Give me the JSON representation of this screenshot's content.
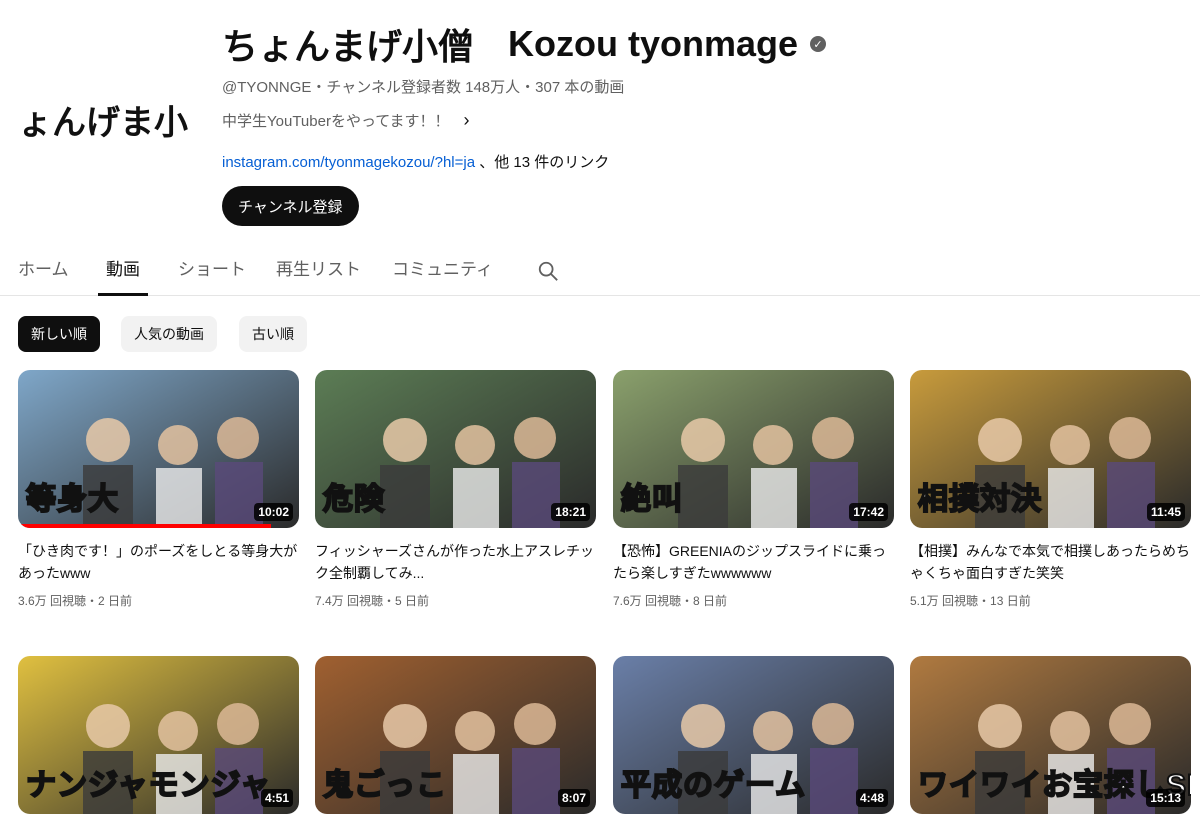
{
  "channel": {
    "avatar_text": "ちょんげま小僧",
    "name_jp": "ちょんまげ小僧",
    "name_en": "Kozou tyonmage",
    "meta": "@TYONNGE・チャンネル登録者数 148万人・307 本の動画",
    "description": "中学生YouTuberをやってます！！",
    "link": "instagram.com/tyonmagekozou/?hl=ja",
    "link_suffix": "、他 13 件のリンク",
    "subscribe_label": "チャンネル登録"
  },
  "tabs": [
    {
      "label": "ホーム"
    },
    {
      "label": "動画"
    },
    {
      "label": "ショート"
    },
    {
      "label": "再生リスト"
    },
    {
      "label": "コミュニティ"
    }
  ],
  "chips": [
    {
      "label": "新しい順"
    },
    {
      "label": "人気の動画"
    },
    {
      "label": "古い順"
    }
  ],
  "videos": [
    {
      "title": "「ひき肉です！」のポーズをしとる等身大があったwww",
      "meta": "3.6万 回視聴・2 日前",
      "duration": "10:02",
      "overlay": "等身大",
      "watched_fraction": 0.9,
      "color": "#7fa7c9"
    },
    {
      "title": "フィッシャーズさんが作った水上アスレチック全制覇してみ...",
      "meta": "7.4万 回視聴・5 日前",
      "duration": "18:21",
      "overlay": "危険",
      "color": "#5c7d55"
    },
    {
      "title": "【恐怖】GREENIAのジップスライドに乗ったら楽しすぎたwwwwww",
      "meta": "7.6万 回視聴・8 日前",
      "duration": "17:42",
      "overlay": "絶叫",
      "color": "#8aa06c"
    },
    {
      "title": "【相撲】みんなで本気で相撲しあったらめちゃくちゃ面白すぎた笑笑",
      "meta": "5.1万 回視聴・13 日前",
      "duration": "11:45",
      "overlay": "相撲対決",
      "color": "#c89b3c"
    },
    {
      "title": "",
      "meta": "",
      "duration": "4:51",
      "overlay": "ナンジャモンジャ",
      "color": "#e0c040"
    },
    {
      "title": "",
      "meta": "",
      "duration": "8:07",
      "overlay": "鬼ごっこ",
      "color": "#a06030"
    },
    {
      "title": "",
      "meta": "",
      "duration": "4:48",
      "overlay": "平成のゲーム",
      "color": "#6a7fa8"
    },
    {
      "title": "",
      "meta": "",
      "duration": "15:13",
      "overlay": "ワイワイお宝探しSP",
      "color": "#b07a40"
    }
  ],
  "icons": {
    "search": "search-icon",
    "verified": "verified-check-icon",
    "chevron": "chevron-right-icon"
  }
}
